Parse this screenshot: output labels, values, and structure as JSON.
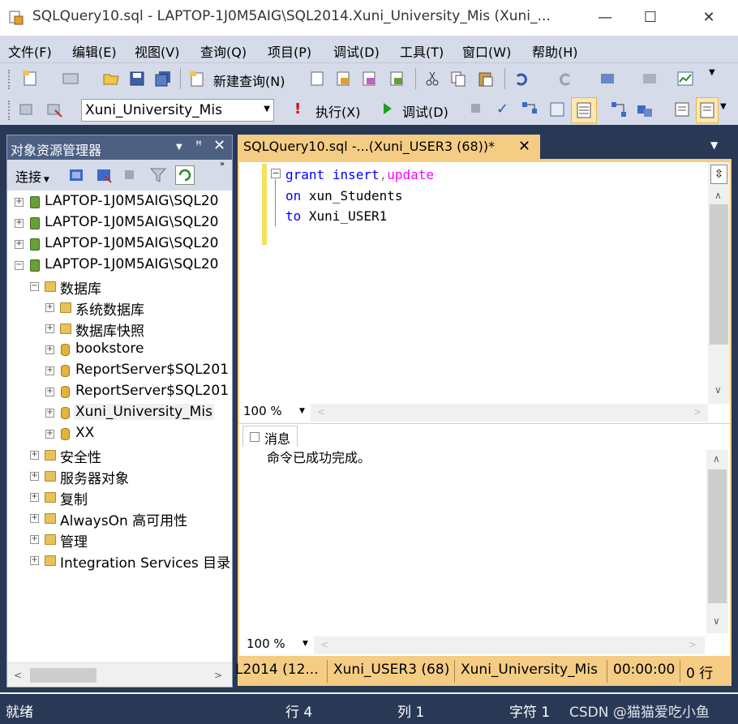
{
  "window": {
    "title": "SQLQuery10.sql - LAPTOP-1J0M5AIG\\SQL2014.Xuni_University_Mis (Xuni_...",
    "minimize": "—",
    "maximize": "☐",
    "close": "✕"
  },
  "menu": [
    "文件(F)",
    "编辑(E)",
    "视图(V)",
    "查询(Q)",
    "项目(P)",
    "调试(D)",
    "工具(T)",
    "窗口(W)",
    "帮助(H)"
  ],
  "toolbar1": {
    "new_query": "新建查询(N)"
  },
  "toolbar2": {
    "database": "Xuni_University_Mis",
    "execute": "执行(X)",
    "debug": "调试(D)"
  },
  "object_explorer": {
    "title": "对象资源管理器",
    "connect": "连接",
    "servers": [
      "LAPTOP-1J0M5AIG\\SQL20",
      "LAPTOP-1J0M5AIG\\SQL20",
      "LAPTOP-1J0M5AIG\\SQL20",
      "LAPTOP-1J0M5AIG\\SQL20"
    ],
    "databases_folder": "数据库",
    "databases": [
      "系统数据库",
      "数据库快照",
      "bookstore",
      "ReportServer$SQL201",
      "ReportServer$SQL201",
      "Xuni_University_Mis",
      "XX"
    ],
    "folders": [
      "安全性",
      "服务器对象",
      "复制",
      "AlwaysOn 高可用性",
      "管理",
      "Integration Services 目录"
    ]
  },
  "editor": {
    "tab_label": "SQLQuery10.sql -...(Xuni_USER3 (68))*",
    "tab_close": "✕",
    "code": {
      "line1_kw1": "grant",
      "line1_kw2": "insert",
      "line1_comma": ",",
      "line1_kw3": "update",
      "line2_kw": "on",
      "line2_obj": "xun_Students",
      "line3_kw": "to",
      "line3_obj": "Xuni_USER1"
    },
    "zoom": "100 %"
  },
  "results": {
    "tab": "消息",
    "message": "命令已成功完成。",
    "zoom": "100 %"
  },
  "query_status": {
    "server": "L2014 (12...",
    "user": "Xuni_USER3 (68)",
    "database": "Xuni_University_Mis",
    "time": "00:00:00",
    "rows": "0 行"
  },
  "statusbar": {
    "ready": "就绪",
    "line": "行 4",
    "col": "列 1",
    "char": "字符 1",
    "watermark": "CSDN @猫猫爱吃小鱼"
  },
  "colors": {
    "chrome": "#d6dbe9",
    "dark_frame": "#293955",
    "tab_active": "#f5cc84",
    "keyword": "#0000ff",
    "function_keyword": "#ff00ff"
  }
}
